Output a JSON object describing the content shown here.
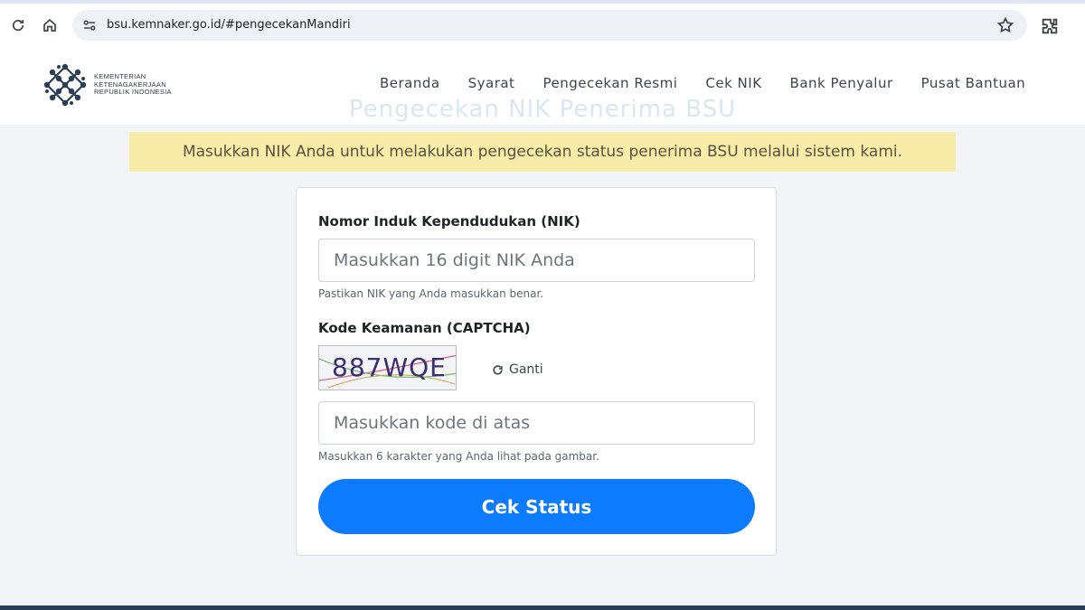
{
  "browser": {
    "url": "bsu.kemnaker.go.id/#pengecekanMandiri"
  },
  "header": {
    "logo_lines": [
      "KEMENTERIAN",
      "KETENAGAKERJAAN",
      "REPUBLIK INDONESIA"
    ],
    "menu": [
      "Beranda",
      "Syarat",
      "Pengecekan Resmi",
      "Cek NIK",
      "Bank Penyalur",
      "Pusat Bantuan"
    ]
  },
  "page": {
    "heading": "Pengecekan NIK Penerima BSU",
    "notice": "Masukkan NIK Anda untuk melakukan pengecekan status penerima BSU melalui sistem kami."
  },
  "form": {
    "nik_label": "Nomor Induk Kependudukan (NIK)",
    "nik_placeholder": "Masukkan 16 digit NIK Anda",
    "nik_hint": "Pastikan NIK yang Anda masukkan benar.",
    "captcha_label": "Kode Keamanan (CAPTCHA)",
    "captcha_code": "887WQE",
    "refresh_label": "Ganti",
    "captcha_placeholder": "Masukkan kode di atas",
    "captcha_hint": "Masukkan 6 karakter yang Anda lihat pada gambar.",
    "submit_label": "Cek Status"
  },
  "colors": {
    "primary": "#0d7bff",
    "notice_bg": "#f8eda8",
    "logo": "#2c3e55"
  }
}
